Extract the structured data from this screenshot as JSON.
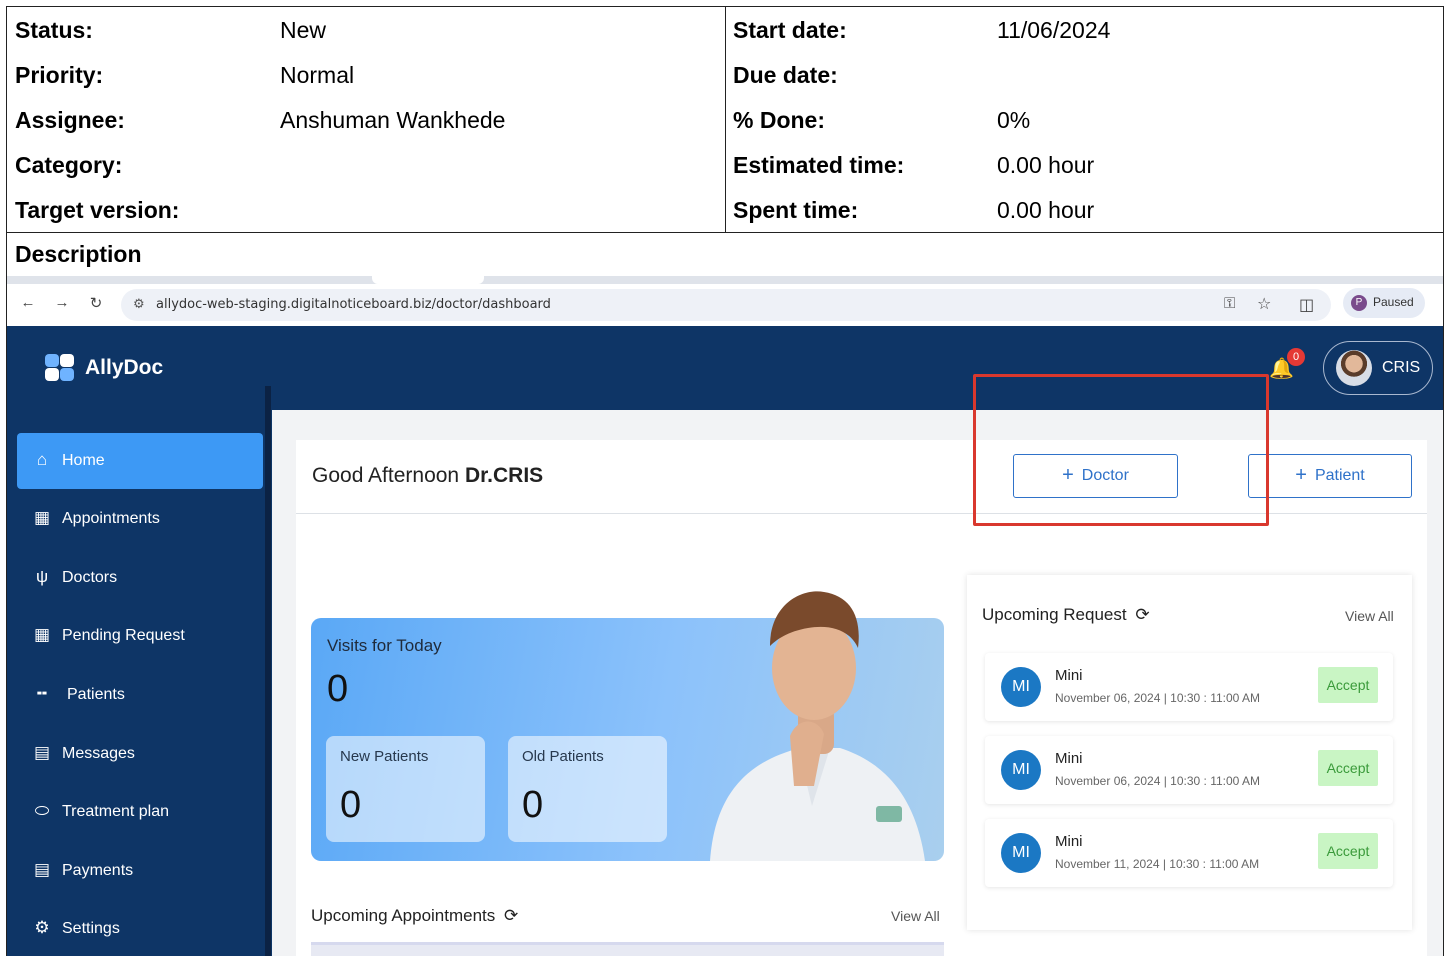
{
  "issue": {
    "left": [
      {
        "label": "Status:",
        "value": "New"
      },
      {
        "label": "Priority:",
        "value": "Normal"
      },
      {
        "label": "Assignee:",
        "value": "Anshuman Wankhede"
      },
      {
        "label": "Category:",
        "value": ""
      },
      {
        "label": "Target version:",
        "value": ""
      }
    ],
    "right": [
      {
        "label": "Start date:",
        "value": "11/06/2024"
      },
      {
        "label": "Due date:",
        "value": ""
      },
      {
        "label": "% Done:",
        "value": "0%"
      },
      {
        "label": "Estimated time:",
        "value": "0.00 hour"
      },
      {
        "label": "Spent time:",
        "value": "0.00 hour"
      }
    ],
    "description_label": "Description"
  },
  "browser": {
    "url": "allydoc-web-staging.digitalnoticeboard.biz/doctor/dashboard",
    "profile_initial": "P",
    "profile_status": "Paused",
    "icons": [
      "back-icon",
      "forward-icon",
      "reload-icon",
      "site-settings-icon",
      "password-key-icon",
      "bookmark-star-icon",
      "extensions-icon"
    ]
  },
  "app": {
    "brand": "AllyDoc",
    "notification_count": "0",
    "user_name": "CRIS",
    "colors": {
      "header": "#0e3566",
      "active": "#3d99f5",
      "accent": "#2f72c9",
      "accept_bg": "#c9f5c4",
      "highlight": "#d9382e"
    },
    "sidebar": [
      {
        "label": "Home",
        "icon": "home-icon",
        "active": true
      },
      {
        "label": "Appointments",
        "icon": "calendar-icon"
      },
      {
        "label": "Doctors",
        "icon": "stethoscope-icon"
      },
      {
        "label": "Pending Request",
        "icon": "calendar-pending-icon"
      },
      {
        "label": "Patients",
        "icon": "bed-icon"
      },
      {
        "label": "Messages",
        "icon": "message-icon"
      },
      {
        "label": "Treatment plan",
        "icon": "pill-icon"
      },
      {
        "label": "Payments",
        "icon": "card-icon"
      },
      {
        "label": "Settings",
        "icon": "gear-icon"
      }
    ],
    "greeting_prefix": "Good Afternoon",
    "greeting_name": "Dr.CRIS",
    "buttons": {
      "doctor": "Doctor",
      "patient": "Patient"
    },
    "visits": {
      "title": "Visits for Today",
      "count": "0",
      "new_label": "New Patients",
      "new_count": "0",
      "old_label": "Old Patients",
      "old_count": "0"
    },
    "upcoming_appointments": {
      "title": "Upcoming Appointments",
      "view_all": "View All"
    },
    "upcoming_request": {
      "title": "Upcoming Request",
      "view_all": "View All",
      "accept_label": "Accept",
      "items": [
        {
          "initials": "MI",
          "name": "Mini",
          "datetime": "November 06, 2024 | 10:30 : 11:00 AM"
        },
        {
          "initials": "MI",
          "name": "Mini",
          "datetime": "November 06, 2024 | 10:30 : 11:00 AM"
        },
        {
          "initials": "MI",
          "name": "Mini",
          "datetime": "November 11, 2024 | 10:30 : 11:00 AM"
        }
      ]
    }
  }
}
